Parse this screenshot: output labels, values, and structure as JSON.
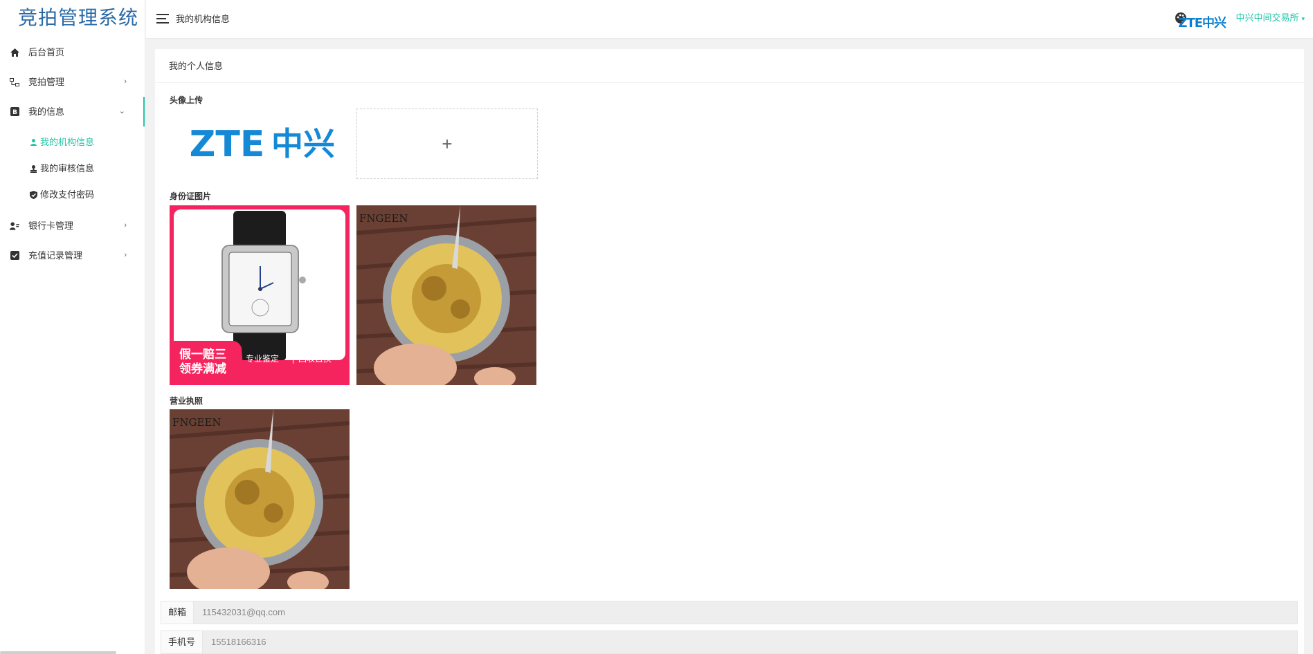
{
  "app": {
    "title": "竞拍管理系统"
  },
  "sidebar": {
    "items": [
      {
        "label": "后台首页",
        "icon": "home-icon"
      },
      {
        "label": "竞拍管理",
        "icon": "sitemap-icon"
      },
      {
        "label": "我的信息",
        "icon": "bold-b-icon"
      },
      {
        "label": "银行卡管理",
        "icon": "user-card-icon"
      },
      {
        "label": "充值记录管理",
        "icon": "check-square-icon"
      }
    ],
    "subitems": [
      {
        "label": "我的机构信息",
        "icon": "user-icon"
      },
      {
        "label": "我的审核信息",
        "icon": "stamp-icon"
      },
      {
        "label": "修改支付密码",
        "icon": "shield-check-icon"
      }
    ],
    "chevron_right": "›",
    "chevron_down": "⌄"
  },
  "header": {
    "breadcrumb": "我的机构信息",
    "brand_logo": "ZTE中兴",
    "user_name": "中兴中间交易所",
    "user_caret": "▾"
  },
  "card": {
    "title": "我的个人信息",
    "avatar_label": "头像上传",
    "avatar_logo": {
      "latin": "ZTE",
      "cjk": "中兴"
    },
    "upload_plus": "+",
    "id_label": "身份证图片",
    "license_label": "营业执照",
    "promo": {
      "line1": "假一赔三",
      "line2": "领券满减",
      "tag1": "专业鉴定",
      "tag2": "回收置换"
    },
    "watch_brand": "FNGEEN",
    "email": {
      "label": "邮箱",
      "value": "115432031@qq.com"
    },
    "phone": {
      "label": "手机号",
      "value": "15518166316"
    }
  },
  "colors": {
    "accent": "#23c6a8",
    "brand": "#2b6aa6",
    "promo_pink": "#f5245e",
    "zte_blue": "#0a7fd0"
  }
}
